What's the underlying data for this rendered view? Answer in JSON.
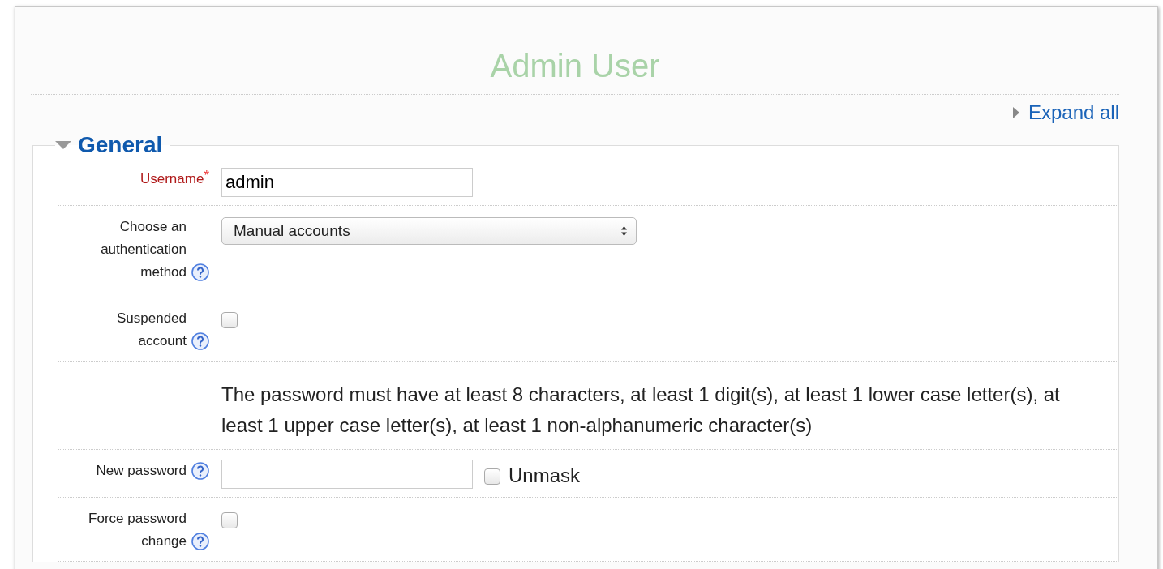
{
  "title": "Admin User",
  "expand_all": {
    "label": "Expand all",
    "expanded": false
  },
  "section": {
    "title": "General",
    "expanded": true,
    "rows": [
      {
        "kind": "text",
        "label": "Username",
        "required": true,
        "required_mark": "*",
        "help": false,
        "value": "admin"
      },
      {
        "kind": "select",
        "label": "Choose an authentication method",
        "required": false,
        "help": true,
        "value": "Manual accounts"
      },
      {
        "kind": "checkbox",
        "label": "Suspended account",
        "required": false,
        "help": true,
        "checked": false
      },
      {
        "kind": "note",
        "text": "The password must have at least 8 characters, at least 1 digit(s), at least 1 lower case letter(s), at least 1 upper case letter(s), at least 1 non-alphanumeric character(s)"
      },
      {
        "kind": "password",
        "label": "New password",
        "required": false,
        "help": true,
        "unmask": {
          "label": "Unmask",
          "checked": false
        }
      },
      {
        "kind": "checkbox",
        "label": "Force password change",
        "required": false,
        "help": true,
        "checked": false
      }
    ]
  }
}
